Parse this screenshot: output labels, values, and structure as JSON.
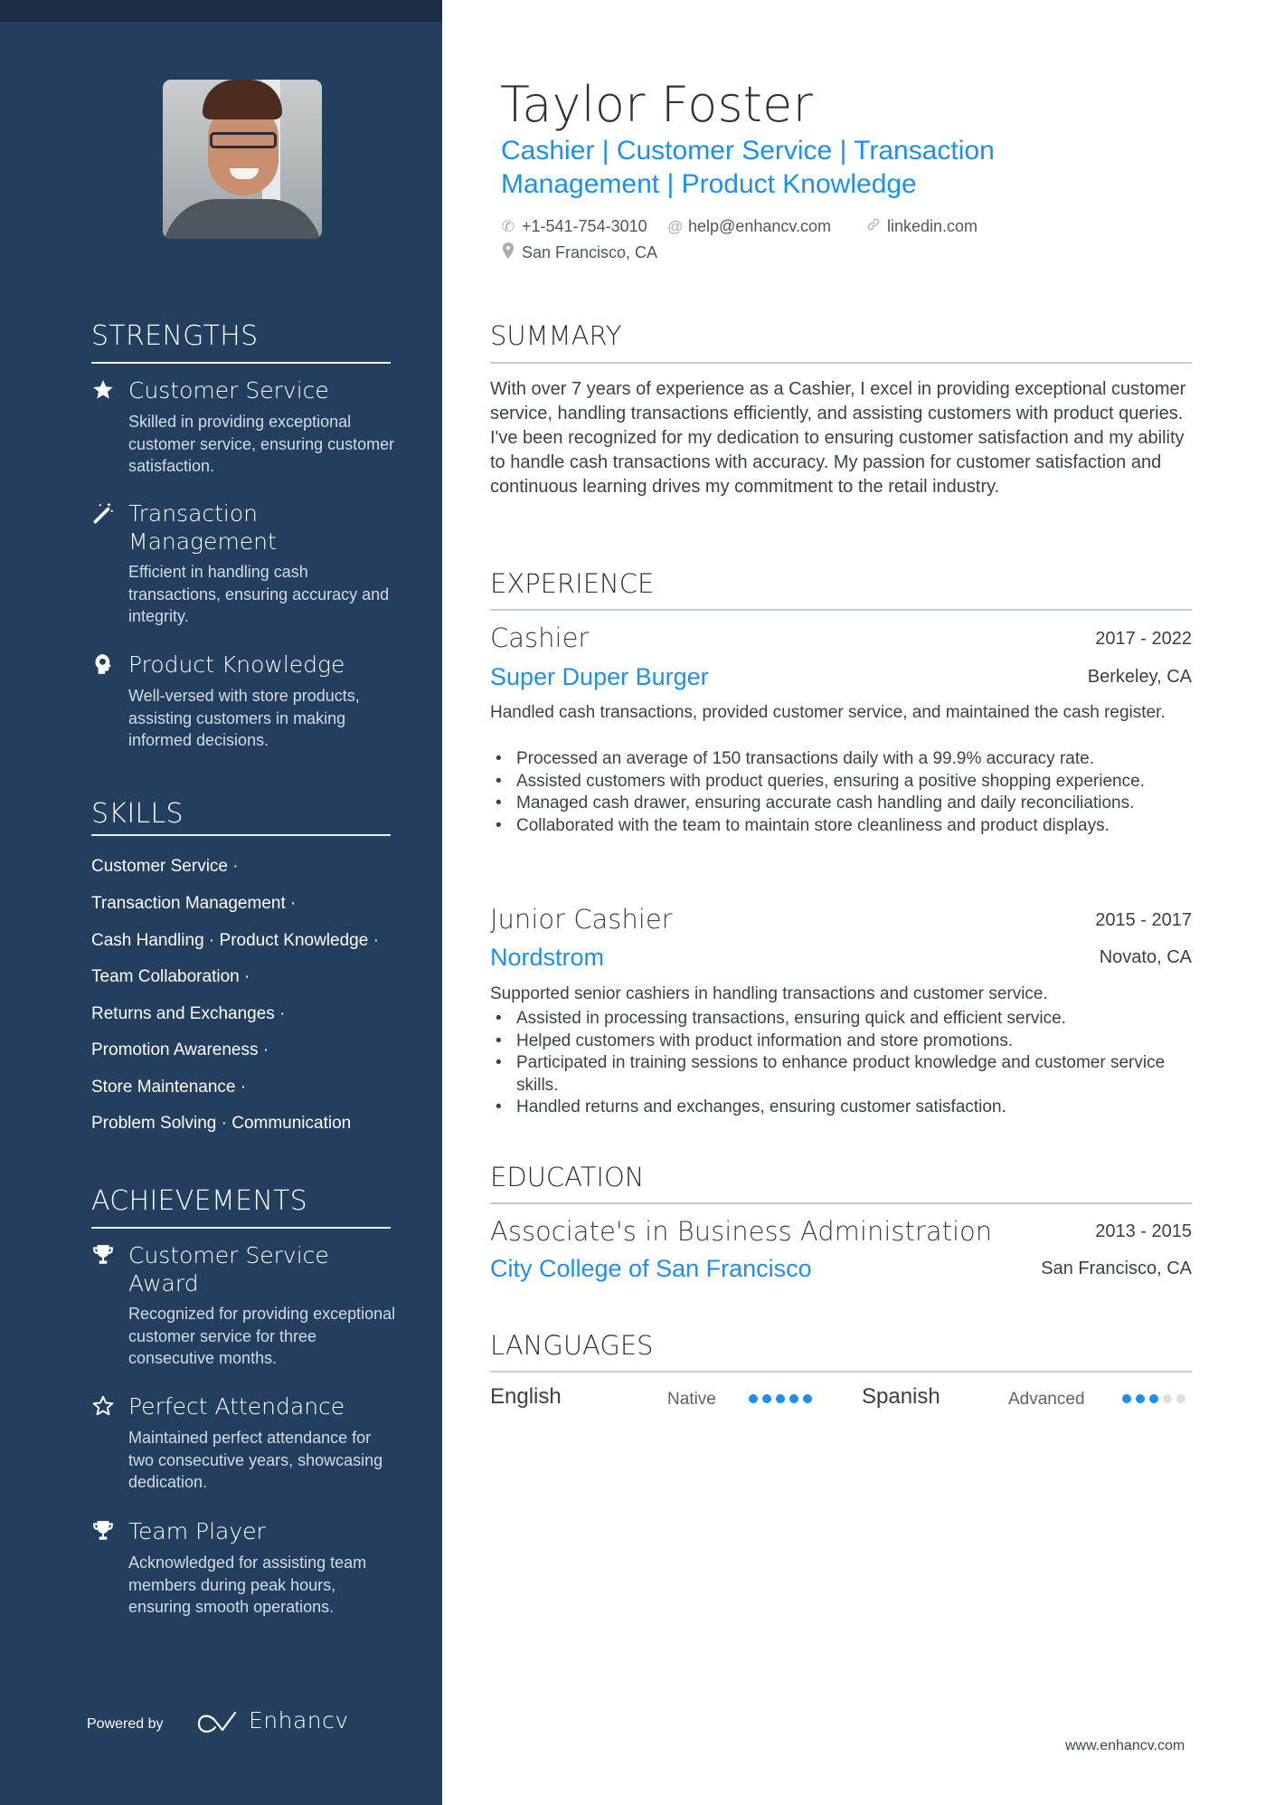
{
  "sidebar": {
    "photo_alt": "Profile photo of Taylor Foster",
    "strengths": {
      "heading": "STRENGTHS",
      "items": [
        {
          "icon": "star-icon",
          "title": "Customer Service",
          "description": "Skilled in providing exceptional customer service, ensuring customer satisfaction."
        },
        {
          "icon": "magic-wand-icon",
          "title": "Transaction Management",
          "description": "Efficient in handling cash transactions, ensuring accuracy and integrity."
        },
        {
          "icon": "head-brain-icon",
          "title": "Product Knowledge",
          "description": "Well-versed with store products, assisting customers in making informed decisions."
        }
      ]
    },
    "skills": {
      "heading": "SKILLS",
      "lines": [
        "Customer Service ·",
        "Transaction Management ·",
        "Cash Handling · Product Knowledge ·",
        "Team Collaboration ·",
        "Returns and Exchanges ·",
        "Promotion Awareness ·",
        "Store Maintenance ·",
        "Problem Solving · Communication"
      ]
    },
    "achievements": {
      "heading": "ACHIEVEMENTS",
      "items": [
        {
          "icon": "trophy-icon",
          "title": "Customer Service Award",
          "description": "Recognized for providing exceptional customer service for three consecutive months."
        },
        {
          "icon": "star-outline-icon",
          "title": "Perfect Attendance",
          "description": "Maintained perfect attendance for two consecutive years, showcasing dedication."
        },
        {
          "icon": "trophy-icon",
          "title": "Team Player",
          "description": "Acknowledged for assisting team members during peak hours, ensuring smooth operations."
        }
      ]
    },
    "footer": {
      "powered_by": "Powered by",
      "brand": "Enhancv"
    }
  },
  "header": {
    "name": "Taylor Foster",
    "headline": "Cashier | Customer Service | Transaction Management | Product Knowledge",
    "contact": {
      "phone": "+1-541-754-3010",
      "email": "help@enhancv.com",
      "website": "linkedin.com",
      "location": "San Francisco, CA"
    }
  },
  "summary": {
    "heading": "SUMMARY",
    "text": "With over 7 years of experience as a Cashier, I excel in providing exceptional customer service, handling transactions efficiently, and assisting customers with product queries. I've been recognized for my dedication to ensuring customer satisfaction and my ability to handle cash transactions with accuracy. My passion for customer satisfaction and continuous learning drives my commitment to the retail industry."
  },
  "experience": {
    "heading": "EXPERIENCE",
    "jobs": [
      {
        "role": "Cashier",
        "dates": "2017 - 2022",
        "company": "Super Duper Burger",
        "location": "Berkeley, CA",
        "description": "Handled cash transactions, provided customer service, and maintained the cash register.",
        "bullets": [
          "Processed an average of 150 transactions daily with a 99.9% accuracy rate.",
          "Assisted customers with product queries, ensuring a positive shopping experience.",
          "Managed cash drawer, ensuring accurate cash handling and daily reconciliations.",
          "Collaborated with the team to maintain store cleanliness and product displays."
        ]
      },
      {
        "role": "Junior Cashier",
        "dates": "2015 - 2017",
        "company": "Nordstrom",
        "location": "Novato, CA",
        "description": "Supported senior cashiers in handling transactions and customer service.",
        "bullets": [
          "Assisted in processing transactions, ensuring quick and efficient service.",
          "Helped customers with product information and store promotions.",
          "Participated in training sessions to enhance product knowledge and customer service skills.",
          "Handled returns and exchanges, ensuring customer satisfaction."
        ]
      }
    ]
  },
  "education": {
    "heading": "EDUCATION",
    "items": [
      {
        "degree": "Associate's in Business Administration",
        "dates": "2013 - 2015",
        "school": "City College of San Francisco",
        "location": "San Francisco, CA"
      }
    ]
  },
  "languages": {
    "heading": "LANGUAGES",
    "items": [
      {
        "name": "English",
        "level": "Native",
        "rating": 5,
        "max": 5
      },
      {
        "name": "Spanish",
        "level": "Advanced",
        "rating": 3,
        "max": 5
      }
    ]
  },
  "footer": {
    "url": "www.enhancv.com"
  },
  "colors": {
    "sidebar_bg": "#223f5d",
    "topbar_bg": "#1b2d45",
    "accent": "#1b8ff2",
    "text": "#3c4246"
  }
}
